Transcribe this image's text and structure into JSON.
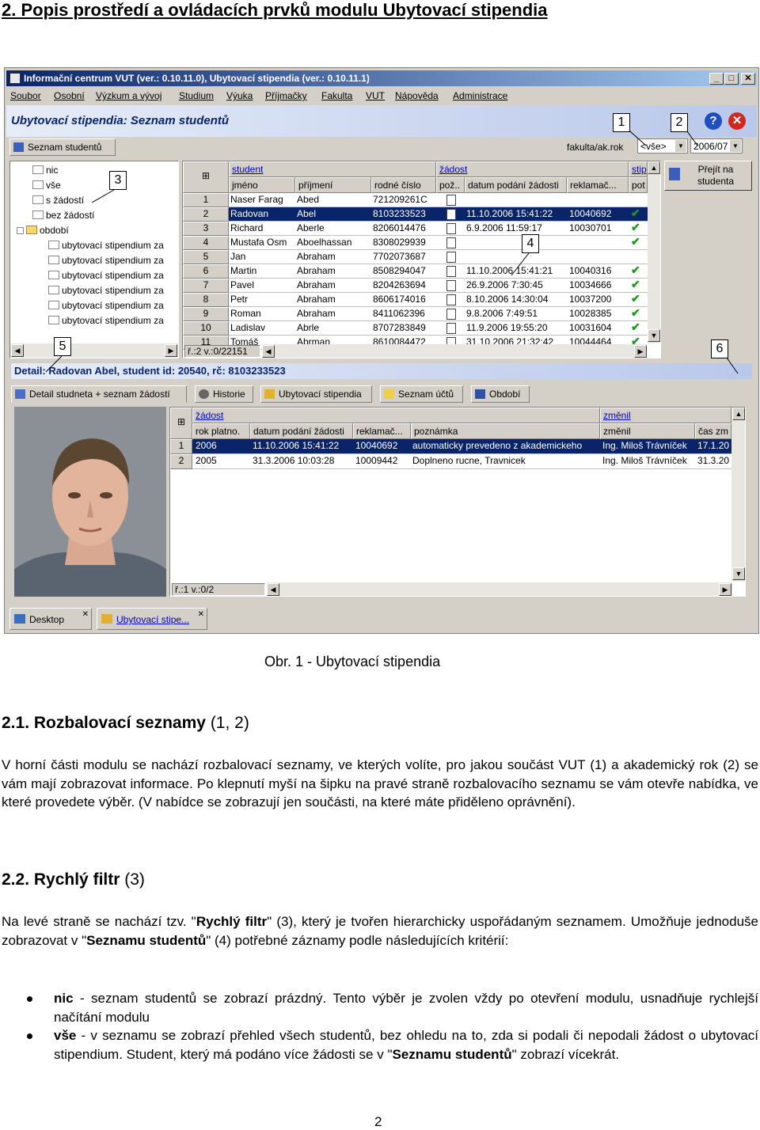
{
  "heading": "2. Popis prostředí a ovládacích prvků modulu Ubytovací stipendia",
  "window": {
    "title": "Informační centrum VUT (ver.: 0.10.11.0), Ubytovací stipendia (ver.: 0.10.11.1)",
    "menu": [
      "Soubor",
      "Osobní",
      "Výzkum a vývoj",
      "Studium",
      "Výuka",
      "Příjmačky",
      "Fakulta",
      "VUT",
      "Nápověda",
      "Administrace"
    ],
    "module_title": "Ubytovací stipendia: Seznam studentů",
    "tab_list": "Seznam studentů",
    "filter_label": "fakulta/ak.rok",
    "faculty_value": "<vše>",
    "year_value": "2006/07",
    "goto_button": "Přejít na studenta",
    "tree": {
      "items": [
        "nic",
        "vše",
        "s žádostí",
        "bez žádostí",
        "období"
      ],
      "subitems": [
        "ubytovací stipendium za",
        "ubytovací stipendium za",
        "ubytovací stipendium za",
        "ubytovací stipendium za",
        "ubytovací stipendium za",
        "ubytovací stipendium za"
      ]
    },
    "grid": {
      "group_student": "student",
      "group_zadost": "žádost",
      "group_stip": "stip",
      "headers": [
        "jméno",
        "příjmení",
        "rodné číslo",
        "pož..",
        "datum podání žádosti",
        "reklamač...",
        "pot"
      ],
      "rows": [
        {
          "n": "1",
          "first": "Naser Farag",
          "last": "Abed",
          "rc": "721209261C",
          "date": "",
          "rekl": "",
          "ok": false
        },
        {
          "n": "2",
          "first": "Radovan",
          "last": "Abel",
          "rc": "8103233523",
          "date": "11.10.2006 15:41:22",
          "rekl": "10040692",
          "ok": true
        },
        {
          "n": "3",
          "first": "Richard",
          "last": "Aberle",
          "rc": "8206014476",
          "date": "6.9.2006 11:59:17",
          "rekl": "10030701",
          "ok": true
        },
        {
          "n": "4",
          "first": "Mustafa Osm",
          "last": "Aboelhassan",
          "rc": "8308029939",
          "date": "",
          "rekl": "",
          "ok": true
        },
        {
          "n": "5",
          "first": "Jan",
          "last": "Abraham",
          "rc": "7702073687",
          "date": "",
          "rekl": "",
          "ok": false
        },
        {
          "n": "6",
          "first": "Martin",
          "last": "Abraham",
          "rc": "8508294047",
          "date": "11.10.2006 15:41:21",
          "rekl": "10040316",
          "ok": true
        },
        {
          "n": "7",
          "first": "Pavel",
          "last": "Abraham",
          "rc": "8204263694",
          "date": "26.9.2006 7:30:45",
          "rekl": "10034666",
          "ok": true
        },
        {
          "n": "8",
          "first": "Petr",
          "last": "Abraham",
          "rc": "8606174016",
          "date": "8.10.2006 14:30:04",
          "rekl": "10037200",
          "ok": true
        },
        {
          "n": "9",
          "first": "Roman",
          "last": "Abraham",
          "rc": "8411062396",
          "date": "9.8.2006 7:49:51",
          "rekl": "10028385",
          "ok": true
        },
        {
          "n": "10",
          "first": "Ladislav",
          "last": "Abrle",
          "rc": "8707283849",
          "date": "11.9.2006 19:55:20",
          "rekl": "10031604",
          "ok": true
        },
        {
          "n": "11",
          "first": "Tomáš",
          "last": "Abrman",
          "rc": "8610084472",
          "date": "31.10.2006 21:32:42",
          "rekl": "10044464",
          "ok": true
        }
      ],
      "status": "ř.:2 v.:0/22151"
    },
    "detail_title": "Detail: Radovan Abel, student id: 20540, rč: 8103233523",
    "detail_tabs": [
      "Detail studneta + seznam žádostí",
      "Historie",
      "Ubytovací stipendia",
      "Seznam účtů",
      "Období"
    ],
    "detail_grid": {
      "group_zadost": "žádost",
      "group_zmenil": "změnil",
      "headers": [
        "rok platno.",
        "datum podání žádosti",
        "reklamač...",
        "poznámka",
        "změnil",
        "čas zm"
      ],
      "rows": [
        {
          "n": "1",
          "rok": "2006",
          "date": "11.10.2006 15:41:22",
          "rekl": "10040692",
          "note": "automaticky prevedeno z akademickeho",
          "who": "Ing. Miloš Trávníček",
          "time": "17.1.20"
        },
        {
          "n": "2",
          "rok": "2005",
          "date": "31.3.2006 10:03:28",
          "rekl": "10009442",
          "note": "Doplneno rucne, Travnicek",
          "who": "Ing. Miloš Trávníček",
          "time": "31.3.20"
        }
      ],
      "status": "ř.:1 v.:0/2"
    },
    "taskbar": [
      "Desktop",
      "Ubytovací stipe..."
    ],
    "callouts": [
      "1",
      "2",
      "3",
      "4",
      "5",
      "6"
    ]
  },
  "caption": "Obr. 1 - Ubytovací stipendia",
  "s21": {
    "num": "2.1.",
    "title": "Rozbalovací seznamy",
    "ref": "(1, 2)",
    "p": "V horní části modulu se nachází rozbalovací seznamy, ve kterých volíte, pro jakou součást VUT (1) a akademický rok (2) se vám mají zobrazovat informace. Po klepnutí myší na šipku na pravé straně rozbalovacího seznamu se vám otevře nabídka, ve které provedete výběr. (V nabídce se zobrazují jen součásti, na které máte přiděleno oprávnění)."
  },
  "s22": {
    "num": "2.2.",
    "title": "Rychlý filtr",
    "ref": "(3)",
    "p1_a": "Na levé straně se nachází tzv. \"",
    "p1_b": "Rychlý filtr",
    "p1_c": "\" (3), který je tvořen hierarchicky uspořádaným seznamem. Umožňuje jednoduše zobrazovat v \"",
    "p1_d": "Seznamu studentů",
    "p1_e": "\" (4) potřebné záznamy podle následujících kritérií:",
    "li1_b": "nic",
    "li1_t": " - seznam studentů se zobrazí prázdný. Tento výběr je zvolen vždy po otevření modulu, usnadňuje rychlejší načítání modulu",
    "li2_b": "vše",
    "li2_t": " - v seznamu se zobrazí přehled všech studentů, bez ohledu na to, zda si podali či nepodali žádost o ubytovací stipendium. Student, který má podáno více žádosti se v \"",
    "li2_b2": "Seznamu studentů",
    "li2_t2": "\" zobrazí vícekrát."
  },
  "page_number": "2"
}
